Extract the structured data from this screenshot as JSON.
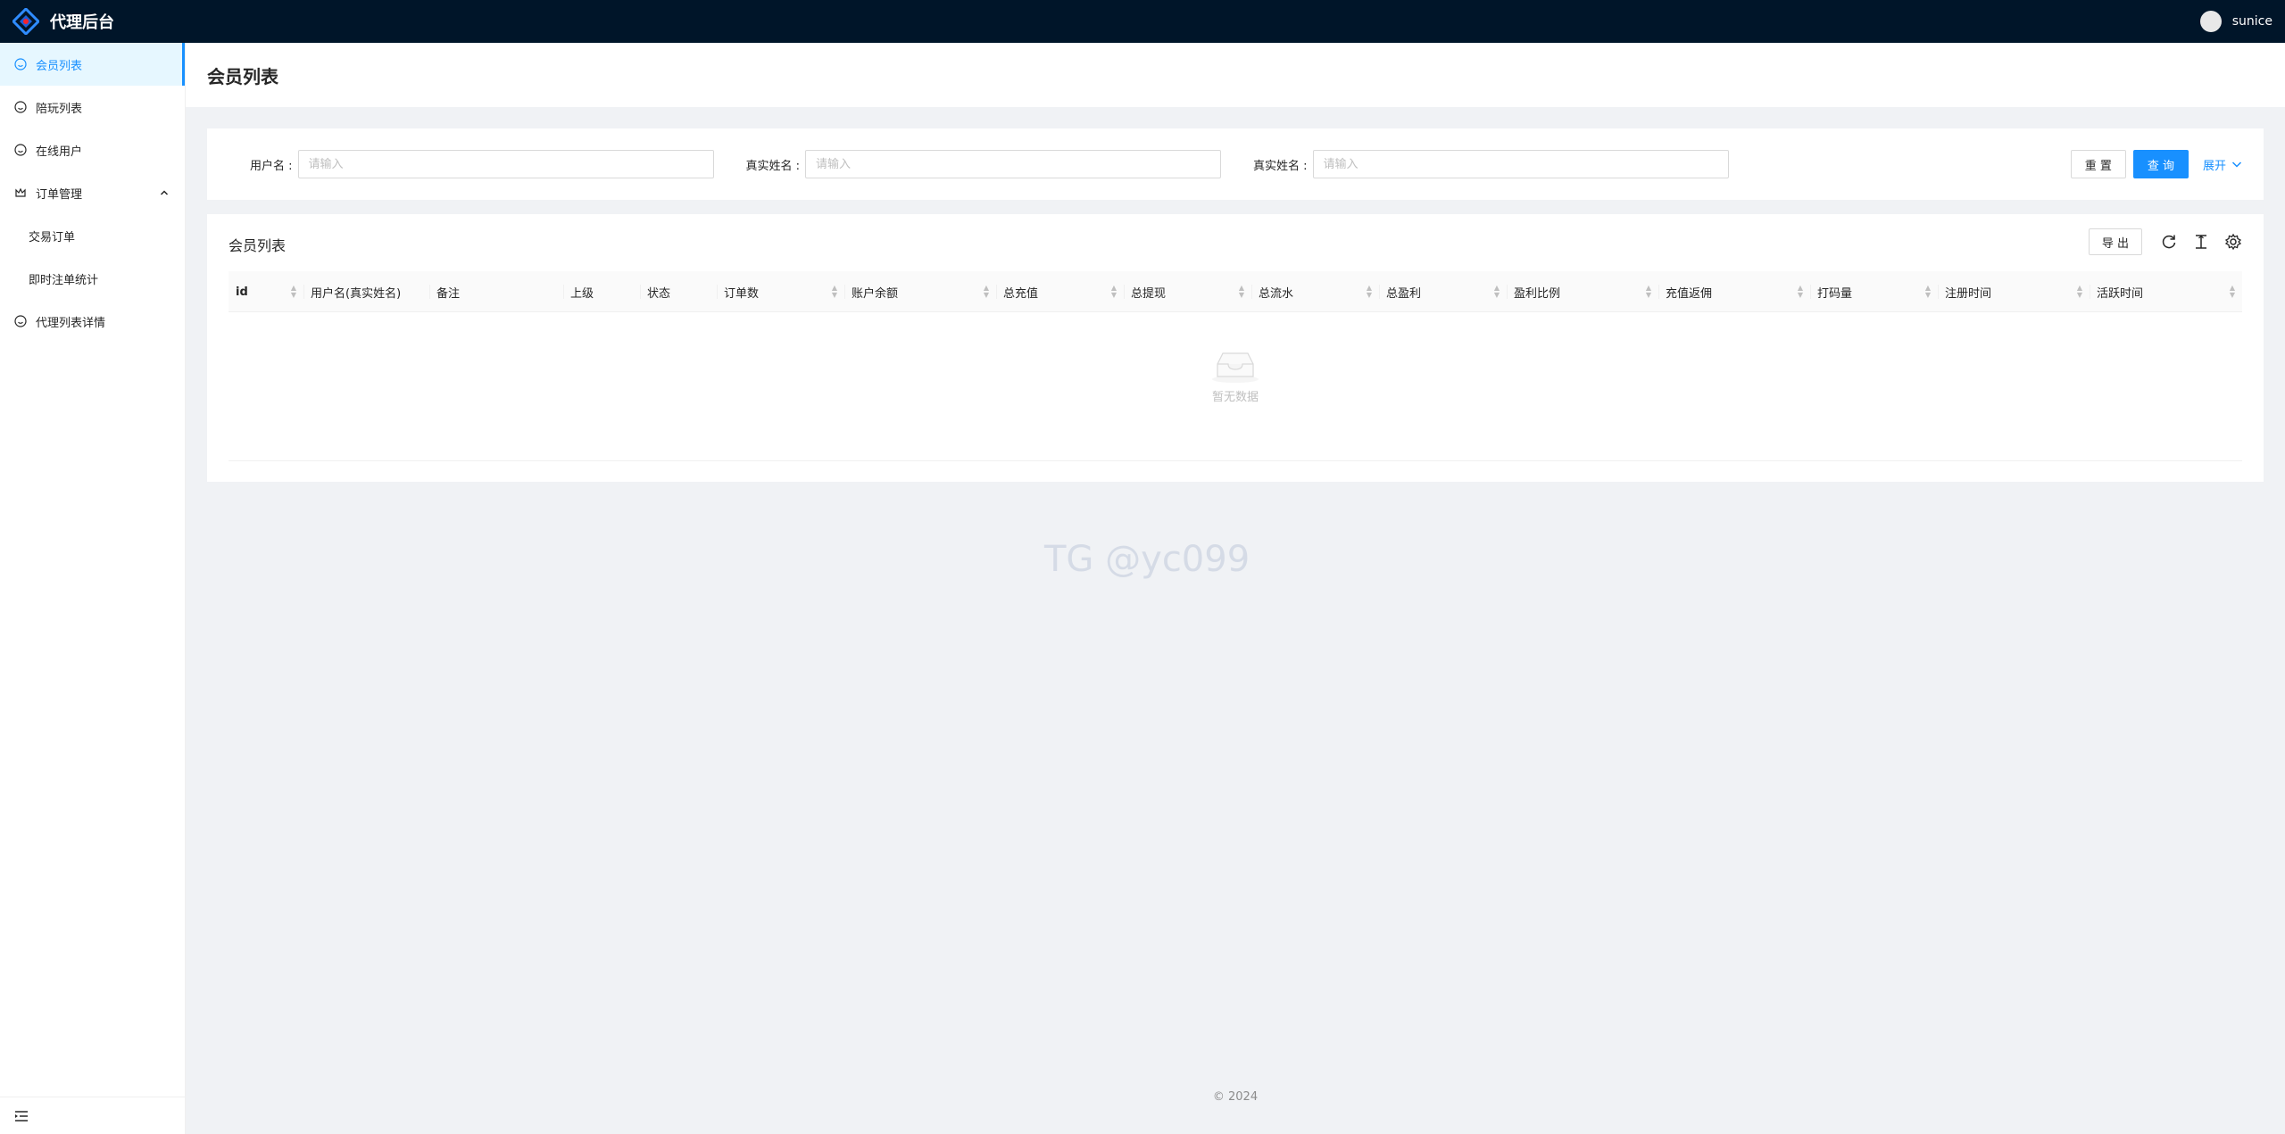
{
  "app": {
    "title": "代理后台",
    "user": "sunice"
  },
  "sidebar": {
    "items": [
      {
        "label": "会员列表",
        "icon": "smile-icon"
      },
      {
        "label": "陪玩列表",
        "icon": "smile-icon"
      },
      {
        "label": "在线用户",
        "icon": "smile-icon"
      },
      {
        "label": "订单管理",
        "icon": "crown-icon"
      },
      {
        "label": "交易订单"
      },
      {
        "label": "即时注单统计"
      },
      {
        "label": "代理列表详情",
        "icon": "smile-icon"
      }
    ]
  },
  "page": {
    "title": "会员列表"
  },
  "search": {
    "fields": [
      {
        "label": "用户名 :",
        "placeholder": "请输入"
      },
      {
        "label": "真实姓名 :",
        "placeholder": "请输入"
      },
      {
        "label": "真实姓名 :",
        "placeholder": "请输入"
      }
    ],
    "reset": "重 置",
    "query": "查 询",
    "expand": "展开"
  },
  "table": {
    "title": "会员列表",
    "export": "导 出",
    "columns": [
      "id",
      "用户名(真实姓名)",
      "备注",
      "上级",
      "状态",
      "订单数",
      "账户余额",
      "总充值",
      "总提现",
      "总流水",
      "总盈利",
      "盈利比例",
      "充值返佣",
      "打码量",
      "注册时间",
      "活跃时间"
    ],
    "empty_text": "暂无数据"
  },
  "watermark": "TG @yc099",
  "footer": "2024",
  "colors": {
    "header_bg": "#001529",
    "primary": "#1890ff",
    "active_bg": "#e6f7ff",
    "page_bg": "#f0f2f5"
  }
}
